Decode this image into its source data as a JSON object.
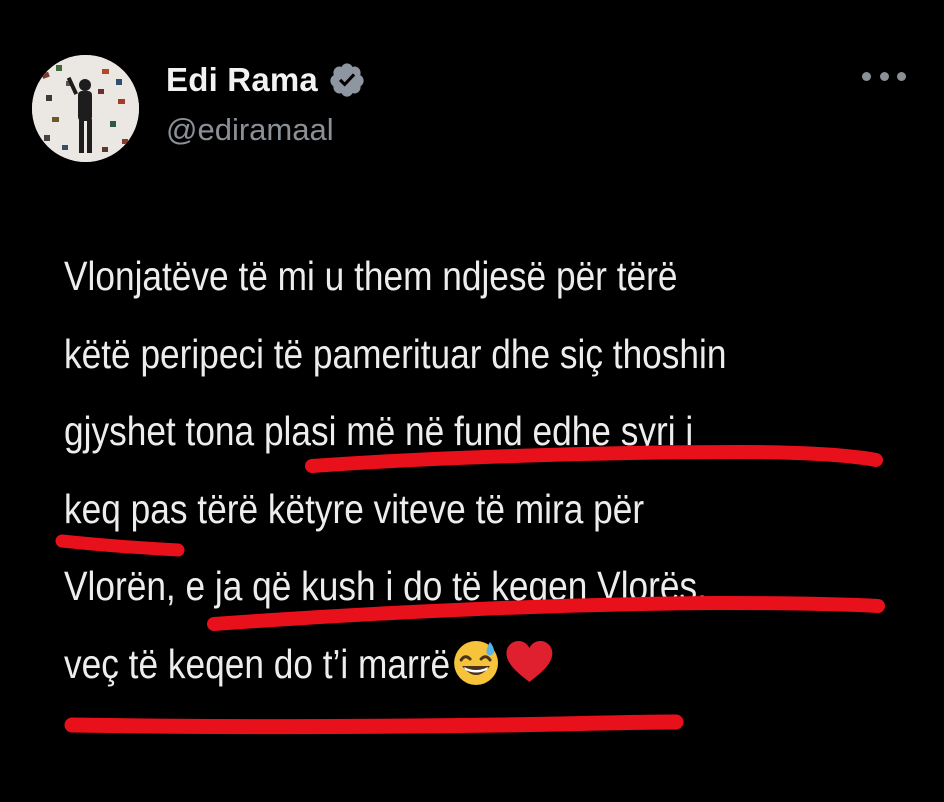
{
  "tweet": {
    "author": {
      "display_name": "Edi Rama",
      "handle": "@ediramaal",
      "verified": true,
      "avatar_icon": "profile-photo-icon"
    },
    "more_icon": "more-horizontal-icon",
    "text_lines": [
      "Vlonjatëve të mi u them ndjesë për tërë",
      "këtë peripeci të pamerituar dhe siç thoshin",
      "gjyshet tona plasi më në fund edhe syri i",
      "keq pas tërë këtyre viteve të mira për",
      "Vlorën, e ja që kush i do të keqen Vlorës,",
      "veç të keqen do t’i marrë"
    ],
    "emojis": [
      "grinning-face-with-sweat-icon",
      "red-heart-icon"
    ]
  },
  "colors": {
    "background": "#000000",
    "text": "#ededed",
    "secondary": "#8b9096",
    "verified_badge": "#8e97a1",
    "annotation_red": "#e8101a"
  }
}
